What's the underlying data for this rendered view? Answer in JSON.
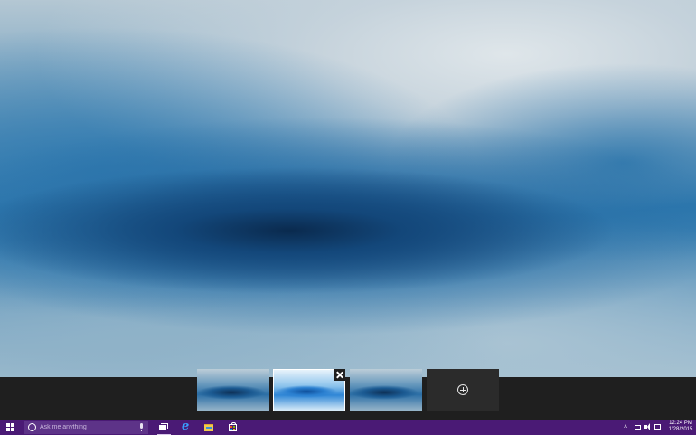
{
  "desktop": {
    "wallpaper": "blue ice cave"
  },
  "task_view": {
    "desktops": [
      {
        "id": "desktop-1",
        "active": false
      },
      {
        "id": "desktop-2",
        "active": true
      },
      {
        "id": "desktop-3",
        "active": false
      }
    ],
    "close_icon": "close-icon",
    "new_desktop_icon": "plus-circle-icon"
  },
  "taskbar": {
    "start_icon": "windows-logo-icon",
    "search": {
      "placeholder": "Ask me anything",
      "cortana_icon": "cortana-circle-icon",
      "mic_icon": "microphone-icon"
    },
    "pinned": [
      {
        "name": "task-view",
        "icon": "task-view-icon"
      },
      {
        "name": "edge",
        "icon": "edge-browser-icon"
      },
      {
        "name": "file-explorer",
        "icon": "folder-icon"
      },
      {
        "name": "store",
        "icon": "store-bag-icon"
      }
    ],
    "tray": {
      "chevron": "˄",
      "time": "12:24 PM",
      "date": "1/28/2015"
    }
  },
  "colors": {
    "taskbar": "#4a1a75",
    "search_box": "#5d3388",
    "task_view_strip": "#1f1f1f",
    "new_desktop_tile": "#2b2b2b"
  }
}
